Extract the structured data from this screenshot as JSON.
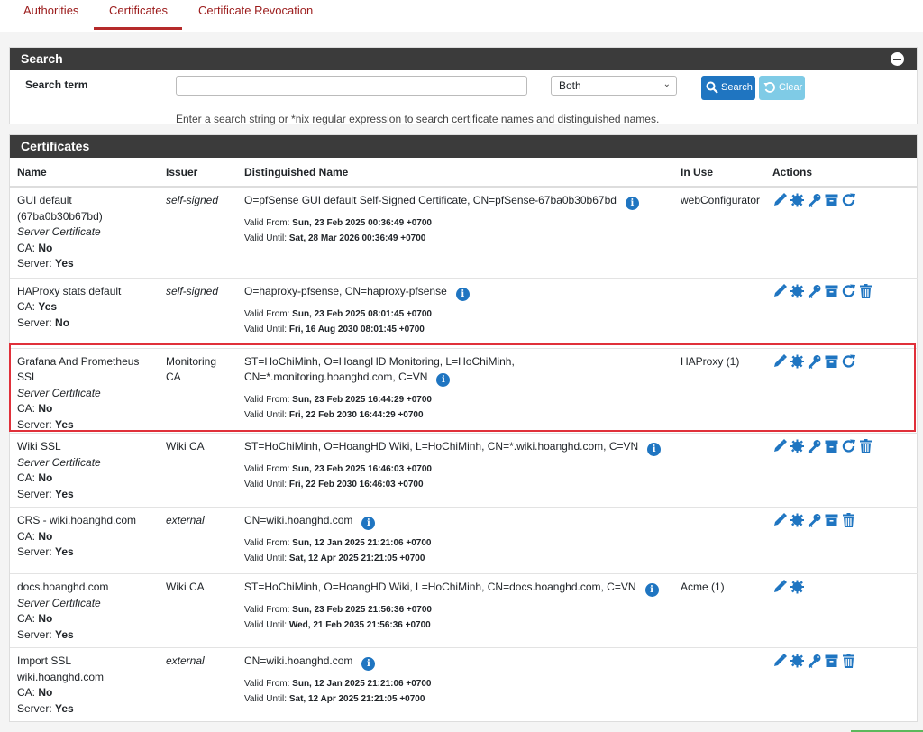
{
  "tabs": [
    "Authorities",
    "Certificates",
    "Certificate Revocation"
  ],
  "search": {
    "heading": "Search",
    "label": "Search term",
    "value": "",
    "placeholder": "",
    "scope": "Both",
    "search_btn": "Search",
    "clear_btn": "Clear",
    "help": "Enter a search string or *nix regular expression to search certificate names and distinguished names."
  },
  "certs": {
    "heading": "Certificates",
    "columns": [
      "Name",
      "Issuer",
      "Distinguished Name",
      "In Use",
      "Actions"
    ],
    "rows": [
      {
        "name": "GUI default (67ba0b30b67bd)",
        "type": "Server Certificate",
        "ca_label": "CA:",
        "ca": "No",
        "server_label": "Server:",
        "server": "Yes",
        "issuer": "self-signed",
        "dn": "O=pfSense GUI default Self-Signed Certificate, CN=pfSense-67ba0b30b67bd",
        "valid_from_label": "Valid From:",
        "valid_from": "Sun, 23 Feb 2025 00:36:49 +0700",
        "valid_until_label": "Valid Until:",
        "valid_until": "Sat, 28 Mar 2026 00:36:49 +0700",
        "in_use": "webConfigurator"
      },
      {
        "name": "HAProxy stats default",
        "type": "",
        "ca_label": "CA:",
        "ca": "Yes",
        "server_label": "Server:",
        "server": "No",
        "issuer": "self-signed",
        "dn": "O=haproxy-pfsense, CN=haproxy-pfsense",
        "valid_from_label": "Valid From:",
        "valid_from": "Sun, 23 Feb 2025 08:01:45 +0700",
        "valid_until_label": "Valid Until:",
        "valid_until": "Fri, 16 Aug 2030 08:01:45 +0700",
        "in_use": ""
      },
      {
        "name": "Grafana And Prometheus SSL",
        "type": "Server Certificate",
        "ca_label": "CA:",
        "ca": "No",
        "server_label": "Server:",
        "server": "Yes",
        "issuer": "Monitoring CA",
        "dn": "ST=HoChiMinh, O=HoangHD Monitoring, L=HoChiMinh, CN=*.monitoring.hoanghd.com, C=VN",
        "valid_from_label": "Valid From:",
        "valid_from": "Sun, 23 Feb 2025 16:44:29 +0700",
        "valid_until_label": "Valid Until:",
        "valid_until": "Fri, 22 Feb 2030 16:44:29 +0700",
        "in_use": "HAProxy (1)"
      },
      {
        "name": "Wiki SSL",
        "type": "Server Certificate",
        "ca_label": "CA:",
        "ca": "No",
        "server_label": "Server:",
        "server": "Yes",
        "issuer": "Wiki CA",
        "dn": "ST=HoChiMinh, O=HoangHD Wiki, L=HoChiMinh, CN=*.wiki.hoanghd.com, C=VN",
        "valid_from_label": "Valid From:",
        "valid_from": "Sun, 23 Feb 2025 16:46:03 +0700",
        "valid_until_label": "Valid Until:",
        "valid_until": "Fri, 22 Feb 2030 16:46:03 +0700",
        "in_use": ""
      },
      {
        "name": "CRS - wiki.hoanghd.com",
        "type": "",
        "ca_label": "CA:",
        "ca": "No",
        "server_label": "Server:",
        "server": "Yes",
        "issuer": "external",
        "dn": "CN=wiki.hoanghd.com",
        "valid_from_label": "Valid From:",
        "valid_from": "Sun, 12 Jan 2025 21:21:06 +0700",
        "valid_until_label": "Valid Until:",
        "valid_until": "Sat, 12 Apr 2025 21:21:05 +0700",
        "in_use": ""
      },
      {
        "name": "docs.hoanghd.com",
        "type": "Server Certificate",
        "ca_label": "CA:",
        "ca": "No",
        "server_label": "Server:",
        "server": "Yes",
        "issuer": "Wiki CA",
        "dn": "ST=HoChiMinh, O=HoangHD Wiki, L=HoChiMinh, CN=docs.hoanghd.com, C=VN",
        "valid_from_label": "Valid From:",
        "valid_from": "Sun, 23 Feb 2025 21:56:36 +0700",
        "valid_until_label": "Valid Until:",
        "valid_until": "Wed, 21 Feb 2035 21:56:36 +0700",
        "in_use": "Acme (1)"
      },
      {
        "name": "Import SSL wiki.hoanghd.com",
        "type": "",
        "ca_label": "CA:",
        "ca": "No",
        "server_label": "Server:",
        "server": "Yes",
        "issuer": "external",
        "dn": "CN=wiki.hoanghd.com",
        "valid_from_label": "Valid From:",
        "valid_from": "Sun, 12 Jan 2025 21:21:06 +0700",
        "valid_until_label": "Valid Until:",
        "valid_until": "Sat, 12 Apr 2025 21:21:05 +0700",
        "in_use": ""
      }
    ]
  },
  "colors": {
    "accent": "#9b1b1b",
    "primary": "#1f75c1",
    "info": "#7fcbe6",
    "heading": "#3b3b3b",
    "highlight": "#e0303a"
  }
}
